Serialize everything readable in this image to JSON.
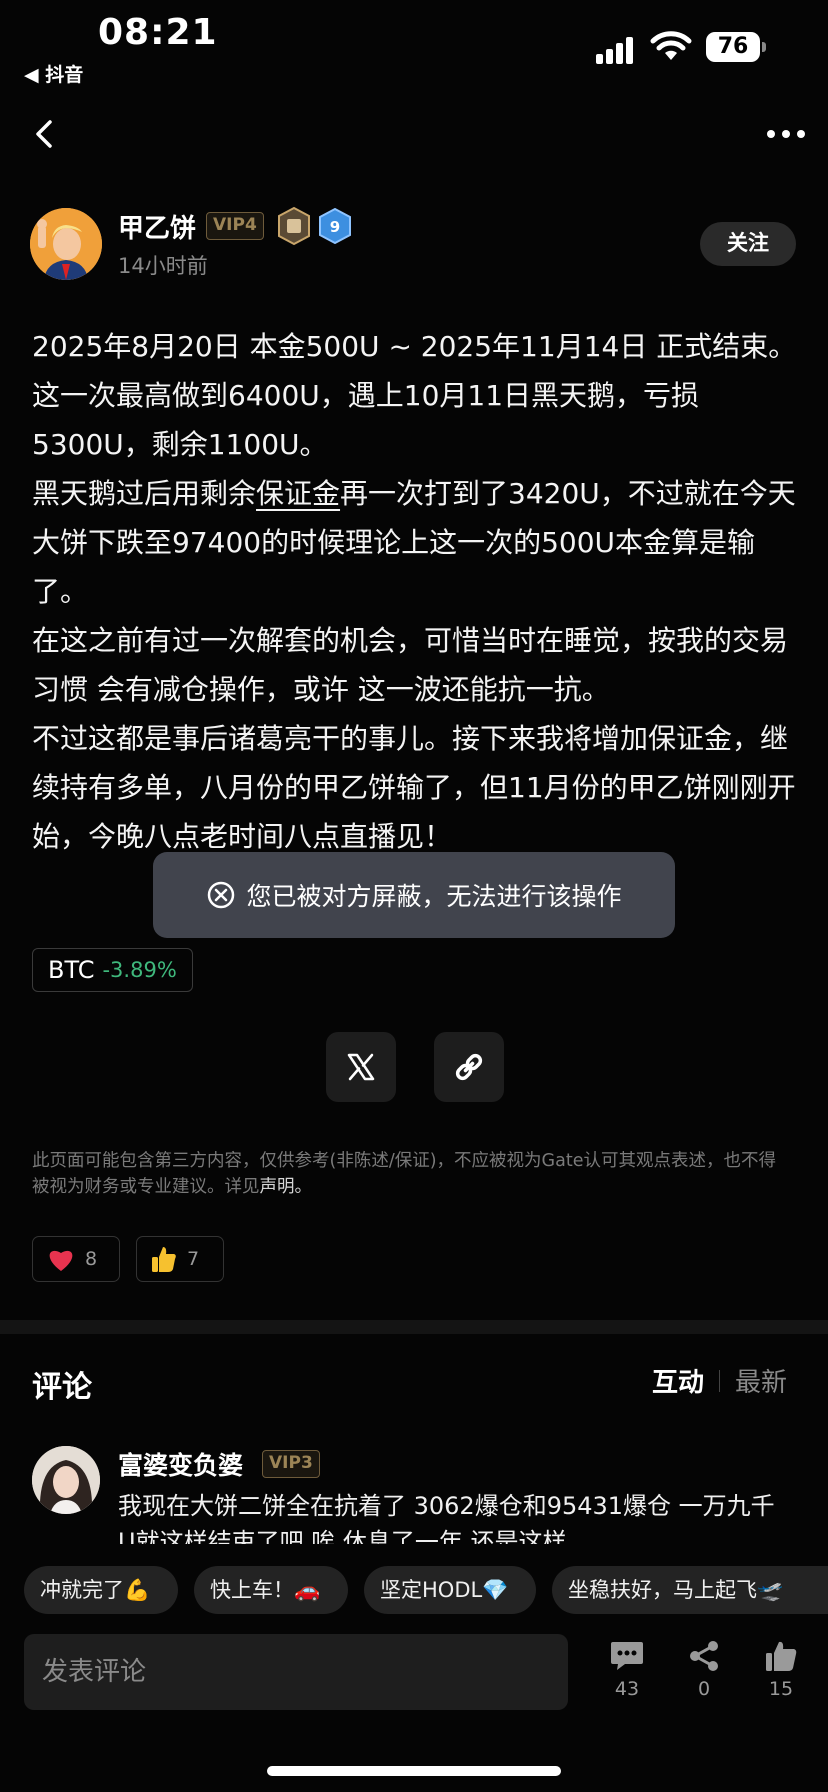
{
  "status_bar": {
    "time": "08:21",
    "back_app": "◀ 抖音",
    "battery": "76"
  },
  "post": {
    "author": {
      "name": "甲乙饼",
      "vip": "VIP4",
      "level": "9"
    },
    "time_ago": "14小时前",
    "follow_label": "关注",
    "body": {
      "p1": "2025年8月20日 本金500U ~ 2025年11月14日 正式结束。",
      "p2": "这一次最高做到6400U，遇上10月11日黑天鹅，亏损5300U，剩余1100U。",
      "p3_before": "黑天鹅过后用剩余",
      "p3_link": "保证金",
      "p3_after": "再一次打到了3420U，不过就在今天 大饼下跌至97400的时候理论上这一次的500U本金算是输了。",
      "p4": "在这之前有过一次解套的机会，可惜当时在睡觉，按我的交易习惯 会有减仓操作，或许 这一波还能抗一抗。",
      "p5": "不过这都是事后诸葛亮干的事儿。接下来我将增加保证金，继续持有多单，八月份的甲乙饼输了，但11月份的甲乙饼刚刚开始，今晚八点老时间八点直播见！"
    },
    "coin": {
      "symbol": "BTC",
      "change": "-3.89%",
      "change_color": "#3fb87c"
    },
    "disclaimer": "此页面可能包含第三方内容，仅供参考(非陈述/保证)，不应被视为Gate认可其观点表述，也不得被视为财务或专业建议。详见",
    "disclaimer_link": "声明。",
    "reactions": {
      "heart": "8",
      "thumbs": "7"
    }
  },
  "toast": "您已被对方屏蔽，无法进行该操作",
  "comments": {
    "title": "评论",
    "sort": {
      "active": "互动",
      "inactive": "最新"
    },
    "items": [
      {
        "name": "富婆变负婆",
        "vip": "VIP3",
        "text": "我现在大饼二饼全在抗着了 3062爆仓和95431爆仓 一万九千U就这样结束了吧 唉 休息了一年 还是这样"
      }
    ]
  },
  "quick_replies": [
    "冲就完了💪",
    "快上车！🚗",
    "坚定HODL💎",
    "坐稳扶好，马上起飞🛫"
  ],
  "bottom_bar": {
    "input_placeholder": "发表评论",
    "comment_count": "43",
    "share_count": "0",
    "like_count": "15"
  }
}
